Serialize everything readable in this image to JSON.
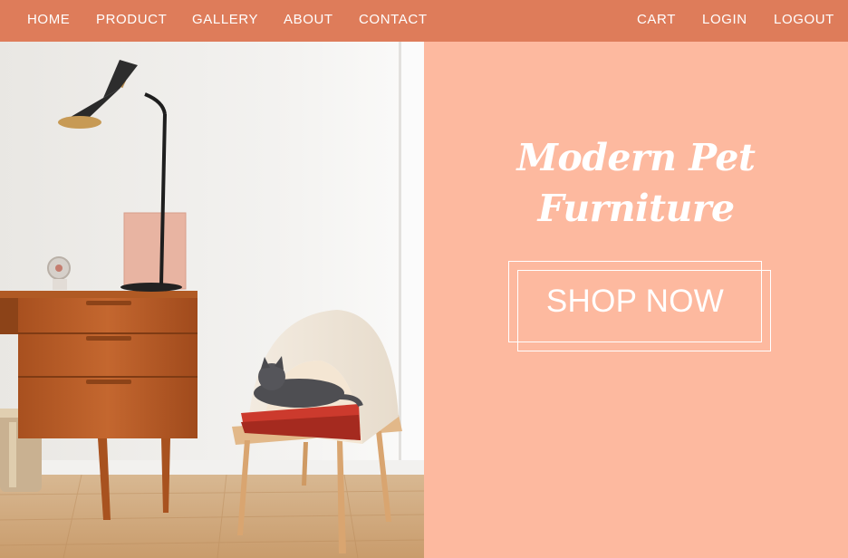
{
  "nav": {
    "left": [
      "HOME",
      "PRODUCT",
      "GALLERY",
      "ABOUT",
      "CONTACT"
    ],
    "right": [
      "CART",
      "LOGIN",
      "LOGOUT"
    ]
  },
  "hero": {
    "title_line1": "Modern Pet",
    "title_line2": "Furniture",
    "cta_label": "SHOP NOW"
  },
  "colors": {
    "nav_bg": "#de7c5a",
    "panel_bg": "#fdb99f",
    "text": "#ffffff"
  },
  "icons": {
    "photo": "room-with-desk-lamp-and-cat-bed-photo"
  }
}
